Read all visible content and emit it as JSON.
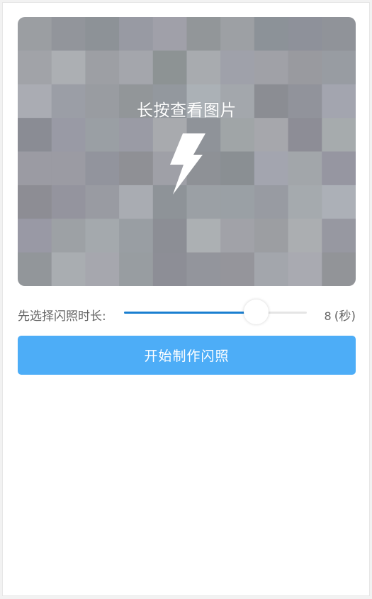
{
  "preview": {
    "hint_text": "长按查看图片",
    "icon": "lightning-bolt-icon"
  },
  "duration_slider": {
    "label": "先选择闪照时长:",
    "value": "8",
    "unit": "(秒)",
    "fill_fraction": 0.72
  },
  "start_button": {
    "label": "开始制作闪照"
  },
  "colors": {
    "slider_active": "#1a7fd0",
    "button_bg": "#4dadf7",
    "button_text": "#ffffff"
  }
}
